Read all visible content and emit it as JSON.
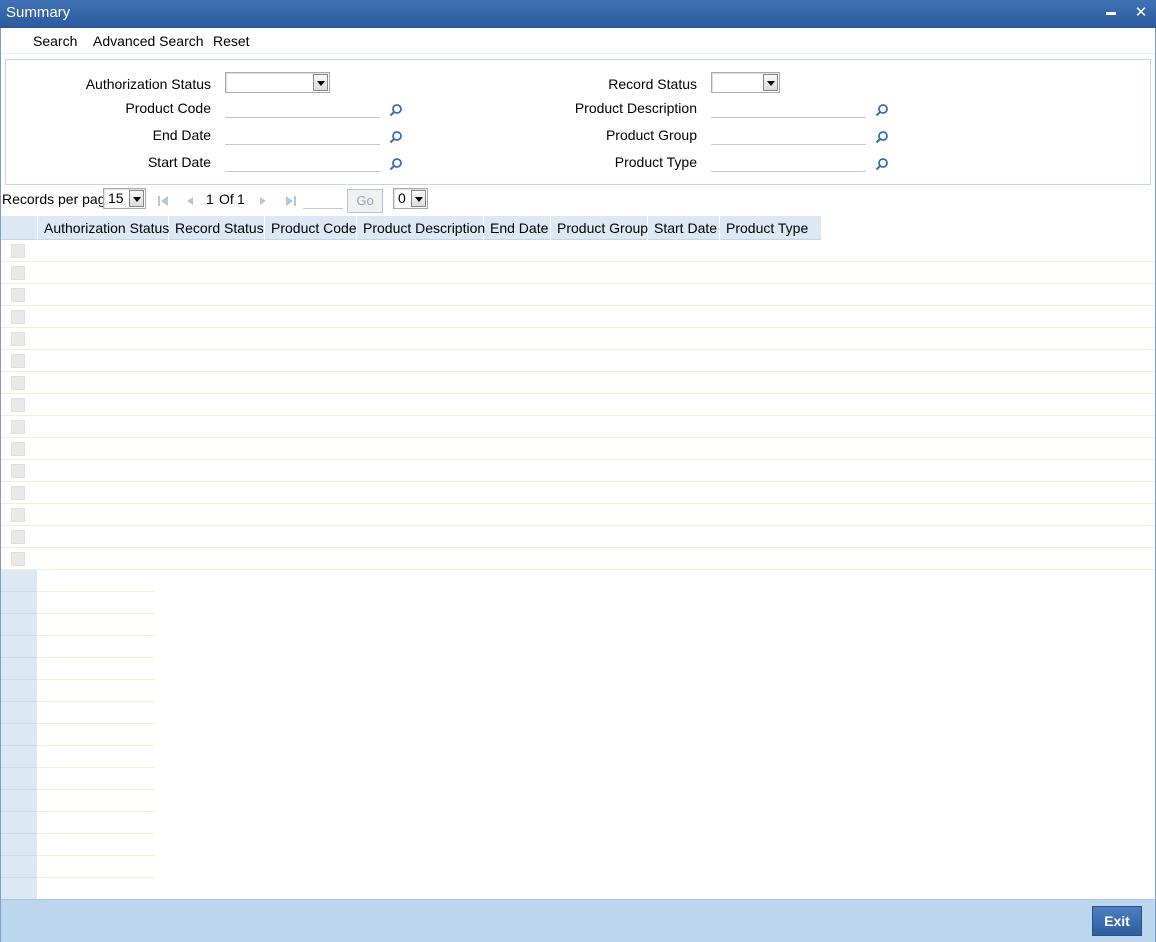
{
  "window": {
    "title": "Summary",
    "minimize_glyph": "▬",
    "close_glyph": "✕"
  },
  "menu": {
    "search": "Search",
    "advanced_search": "Advanced Search",
    "reset": "Reset"
  },
  "form": {
    "authorization_status_label": "Authorization Status",
    "product_code_label": "Product Code",
    "end_date_label": "End Date",
    "start_date_label": "Start Date",
    "record_status_label": "Record Status",
    "product_description_label": "Product Description",
    "product_group_label": "Product Group",
    "product_type_label": "Product Type",
    "authorization_status_value": "",
    "record_status_value": "",
    "product_code_value": "",
    "end_date_value": "",
    "start_date_value": "",
    "product_description_value": "",
    "product_group_value": "",
    "product_type_value": ""
  },
  "pager": {
    "records_per_page_label": "Records per page",
    "records_per_page_value": "15",
    "page_current": "1",
    "page_of_label": "Of",
    "page_total": "1",
    "goto_value": "",
    "go_label": "Go",
    "lock_columns_value": "0"
  },
  "grid": {
    "columns": [
      "Authorization Status",
      "Record Status",
      "Product Code",
      "Product Description",
      "End Date",
      "Product Group",
      "Start Date",
      "Product Type"
    ],
    "row_count": 15
  },
  "footer": {
    "exit_label": "Exit"
  },
  "icons": {
    "lov": "search-icon",
    "first": "first-page-icon",
    "prev": "previous-page-icon",
    "next": "next-page-icon",
    "last": "last-page-icon"
  },
  "colors": {
    "title_bar": "#2b5a9c",
    "header_bg": "#dde8f5",
    "footer_bg": "#bcd6ee",
    "exit_button": "#3b6cae"
  }
}
